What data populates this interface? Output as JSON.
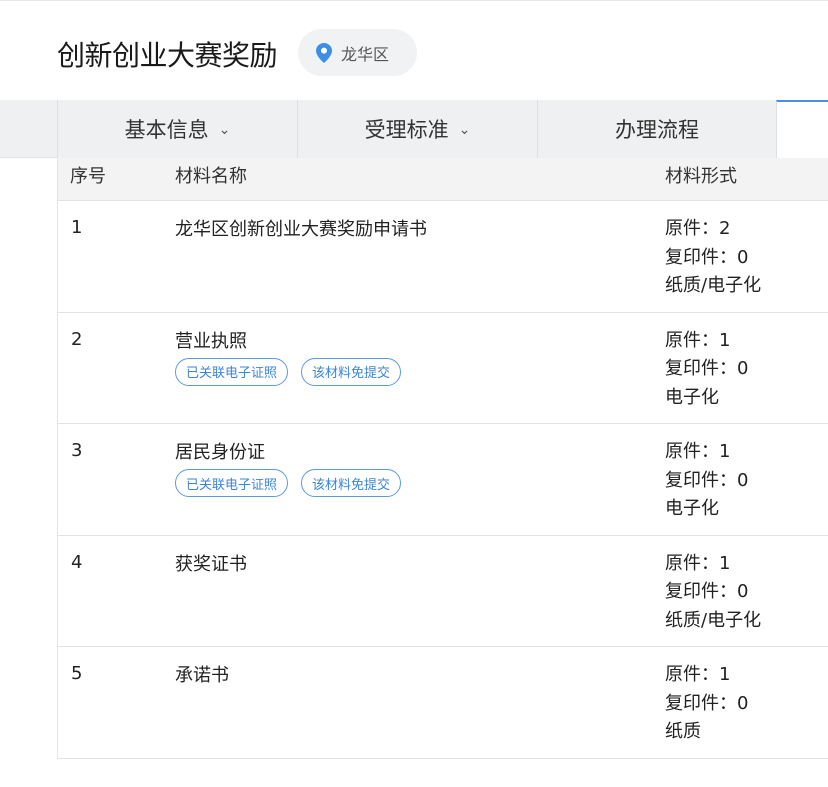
{
  "header": {
    "title": "创新创业大赛奖励",
    "location": "龙华区"
  },
  "tabs": [
    {
      "label": "基本信息",
      "has_dropdown": true
    },
    {
      "label": "受理标准",
      "has_dropdown": true
    },
    {
      "label": "办理流程",
      "has_dropdown": false
    }
  ],
  "table": {
    "headers": {
      "no": "序号",
      "name": "材料名称",
      "form": "材料形式"
    },
    "rows": [
      {
        "no": "1",
        "name": "龙华区创新创业大赛奖励申请书",
        "tags": [],
        "original": "原件：2",
        "copy": "复印件：0",
        "medium": "纸质/电子化"
      },
      {
        "no": "2",
        "name": "营业执照",
        "tags": [
          "已关联电子证照",
          "该材料免提交"
        ],
        "original": "原件：1",
        "copy": "复印件：0",
        "medium": "电子化"
      },
      {
        "no": "3",
        "name": "居民身份证",
        "tags": [
          "已关联电子证照",
          "该材料免提交"
        ],
        "original": "原件：1",
        "copy": "复印件：0",
        "medium": "电子化"
      },
      {
        "no": "4",
        "name": "获奖证书",
        "tags": [],
        "original": "原件：1",
        "copy": "复印件：0",
        "medium": "纸质/电子化"
      },
      {
        "no": "5",
        "name": "承诺书",
        "tags": [],
        "original": "原件：1",
        "copy": "复印件：0",
        "medium": "纸质"
      }
    ]
  },
  "colors": {
    "accent": "#4a90e2",
    "tag_border": "#5b9be0",
    "tab_bg": "#eef0f2",
    "header_bg": "#f3f3f3"
  },
  "icons": {
    "location": "location-pin-icon",
    "dropdown": "chevron-down-icon"
  }
}
